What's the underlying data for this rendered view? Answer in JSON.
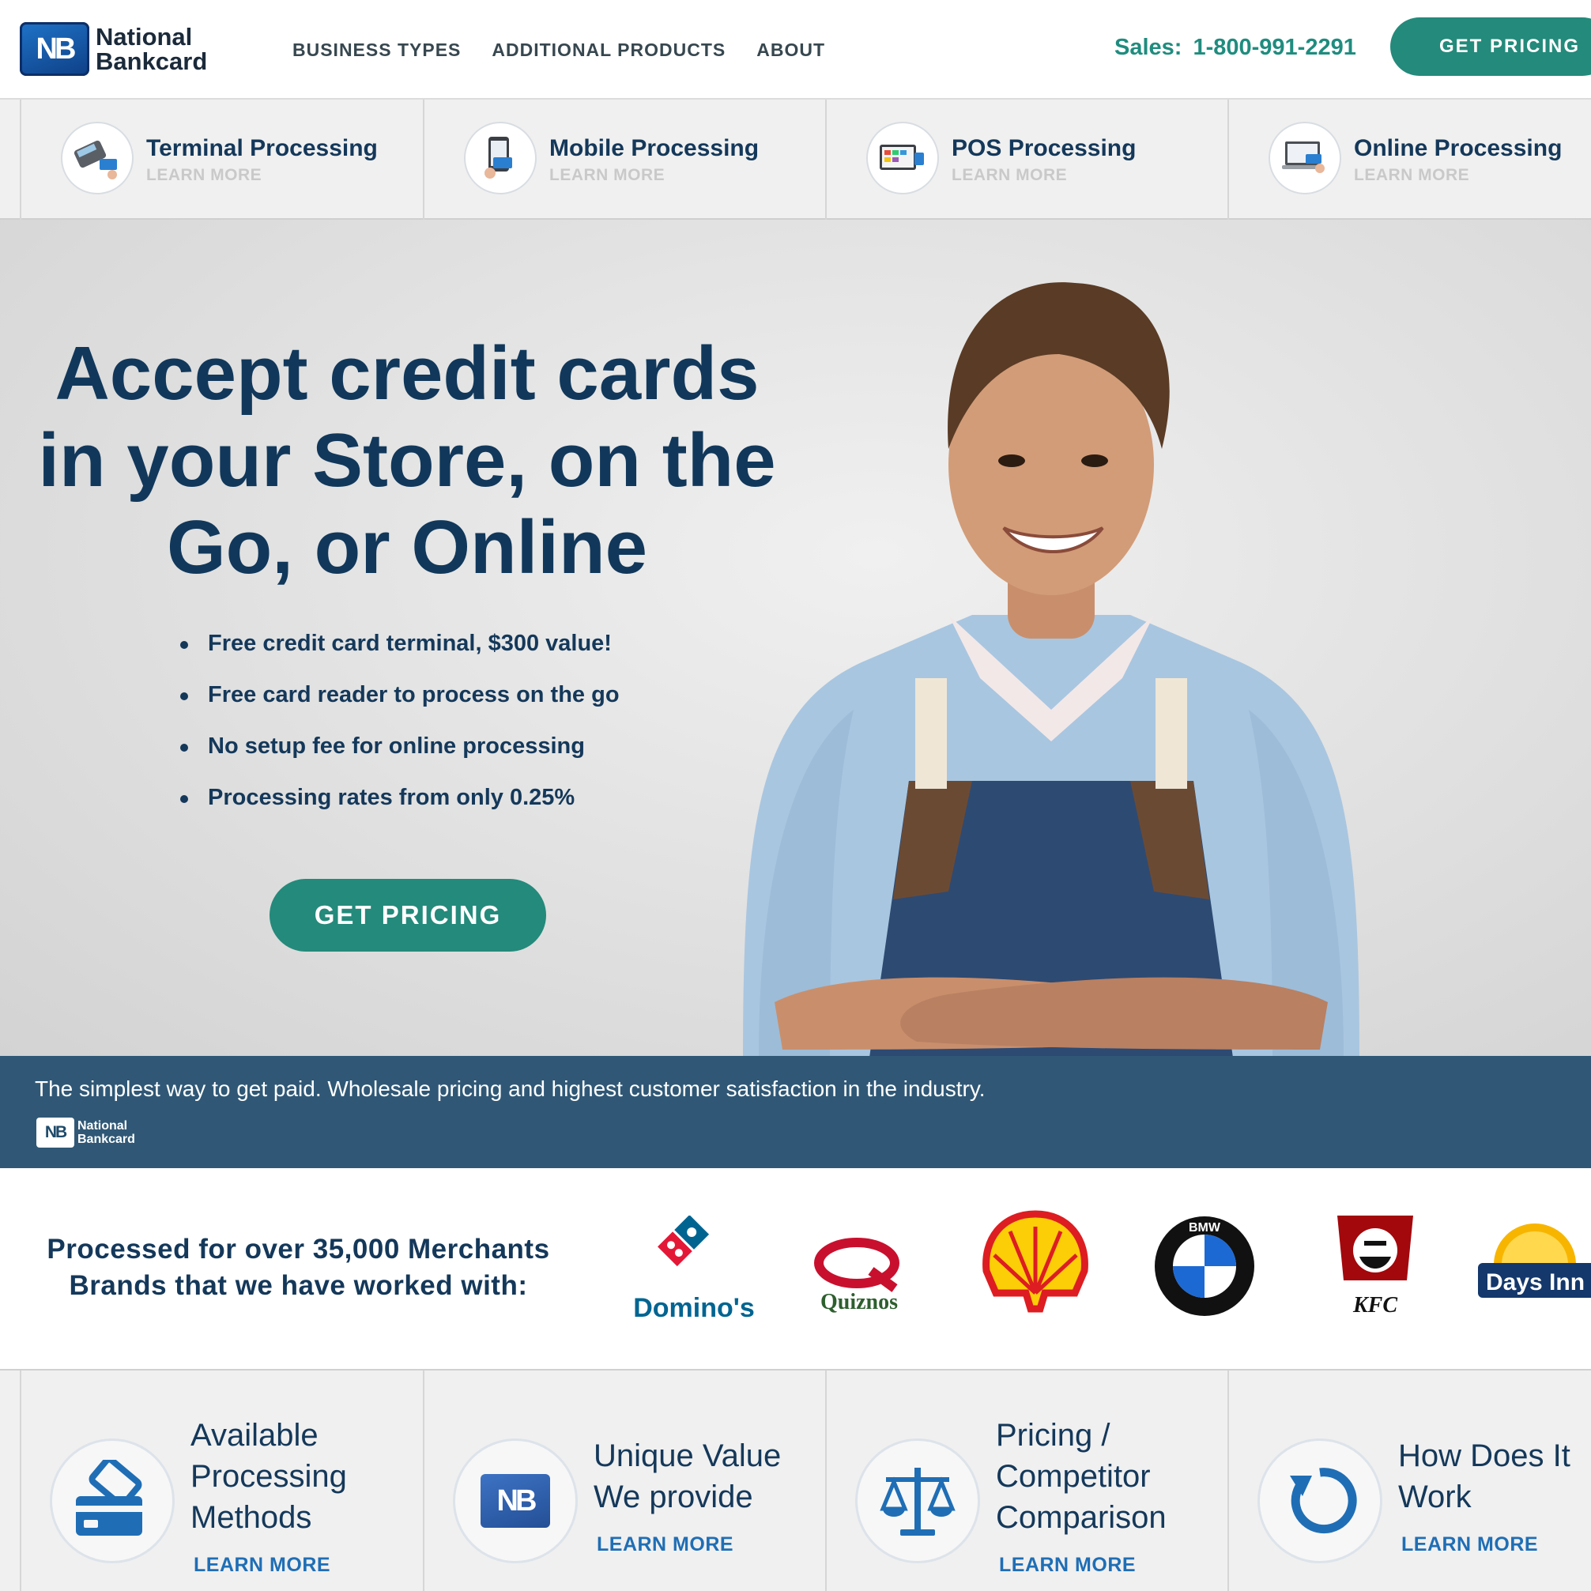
{
  "brand": {
    "logo_mark": "NB",
    "name_line1": "National",
    "name_line2": "Bankcard"
  },
  "nav": {
    "items": [
      "BUSINESS TYPES",
      "ADDITIONAL PRODUCTS",
      "ABOUT"
    ],
    "sales_label": "Sales:",
    "sales_phone": "1-800-991-2291",
    "cta": "GET PRICING"
  },
  "products": [
    {
      "title": "Terminal Processing",
      "more": "LEARN MORE",
      "icon": "card-terminal-icon"
    },
    {
      "title": "Mobile Processing",
      "more": "LEARN MORE",
      "icon": "mobile-reader-icon"
    },
    {
      "title": "POS Processing",
      "more": "LEARN MORE",
      "icon": "pos-register-icon"
    },
    {
      "title": "Online Processing",
      "more": "LEARN MORE",
      "icon": "laptop-payment-icon"
    }
  ],
  "hero": {
    "headline_line1": "Accept credit cards",
    "headline_line2": "in your Store, on the",
    "headline_line3": "Go, or Online",
    "bullets": [
      "Free credit card terminal, $300 value!",
      "Free card reader to process on the go",
      "No setup fee for online processing",
      "Processing rates from only 0.25%"
    ],
    "cta": "GET PRICING",
    "tagline": "The simplest way to get paid. Wholesale pricing and highest customer satisfaction in the industry.",
    "mini_logo_mark": "NB",
    "mini_logo_line1": "National",
    "mini_logo_line2": "Bankcard"
  },
  "brands": {
    "line1": "Processed for over 35,000 Merchants",
    "line2": "Brands that we have worked with:",
    "logos": [
      {
        "name": "Domino's"
      },
      {
        "name": "Quiznos"
      },
      {
        "name": "Shell"
      },
      {
        "name": "BMW"
      },
      {
        "name": "KFC"
      },
      {
        "name": "Days Inn"
      }
    ]
  },
  "features": [
    {
      "line1": "Available",
      "line2": "Processing",
      "line3": "Methods",
      "more": "LEARN MORE",
      "icon": "credit-card-icon"
    },
    {
      "line1": "Unique Value",
      "line2": "We provide",
      "line3": "",
      "more": "LEARN MORE",
      "icon": "nb-logo-icon"
    },
    {
      "line1": "Pricing /",
      "line2": "Competitor",
      "line3": "Comparison",
      "more": "LEARN MORE",
      "icon": "scale-icon"
    },
    {
      "line1": "How Does It",
      "line2": "Work",
      "line3": "",
      "more": "LEARN MORE",
      "icon": "refresh-icon"
    }
  ],
  "colors": {
    "navy": "#14385a",
    "teal": "#248a7b",
    "link_blue": "#1f6eb5",
    "tagline_bar": "#1e4a6a"
  }
}
